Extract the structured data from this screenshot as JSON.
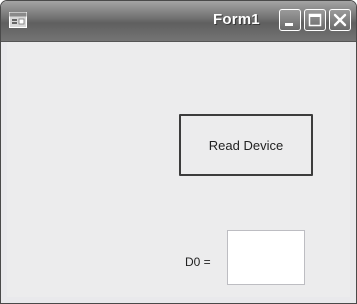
{
  "window": {
    "title": "Form1",
    "icon": "form-app-icon",
    "controls": [
      "minimize-icon",
      "maximize-icon",
      "close-icon"
    ]
  },
  "form": {
    "read_button_label": "Read Device",
    "d0_label": "D0 =",
    "d0_value": ""
  }
}
